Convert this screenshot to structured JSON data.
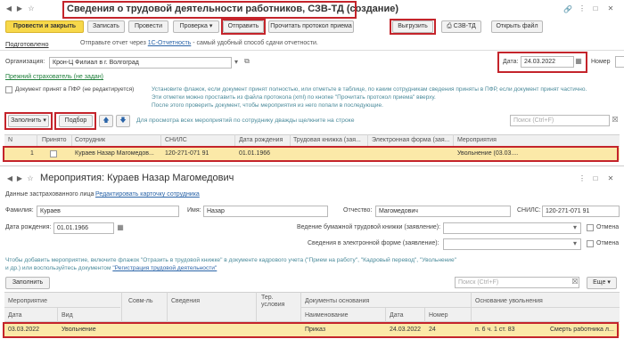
{
  "window": {
    "title": "Сведения о трудовой деятельности работников, СЗВ-ТД (создание)",
    "icons": [
      "link-icon",
      "more-icon",
      "maximize-icon",
      "close-icon",
      "back-icon",
      "forward-icon",
      "star-icon"
    ]
  },
  "tabs": {
    "active": "Подготовлено"
  },
  "toolbar": {
    "post_close": "Провести и закрыть",
    "save": "Записать",
    "post": "Провести",
    "check": "Проверка",
    "send": "Отправить",
    "read_protocol": "Прочитать протокол приема",
    "upload": "Выгрузить",
    "szv": "СЗВ-ТД",
    "open_file": "Открыть файл"
  },
  "notice": {
    "prefix": "Отправьте отчет через",
    "link": "1С-Отчетность",
    "suffix": "- самый удобный способ сдачи отчетности."
  },
  "org": {
    "label": "Организация:",
    "value": "Крон-Ц  Филиал в г. Волгоград",
    "date_label": "Дата:",
    "date_value": "24.03.2022",
    "number_label": "Номер"
  },
  "prev_insurer": "Прежний страхователь (не задан)",
  "accepted": {
    "label": "Документ принят в ПФР (не редактируется)",
    "hint1": "Установите флажок, если документ принят полностью, или отметьте в таблице, по каким сотрудникам сведения приняты в ПФР, если документ принят частично.",
    "hint2": "Эти отметки можно проставить из файла протокола (xml) по кнопке \"Прочитать протокол приема\" вверху.",
    "hint3": "После этого проверить документ, чтобы мероприятия из него попали в последующие."
  },
  "list_toolbar": {
    "fill": "Заполнить",
    "select": "Подбор",
    "hint": "Для просмотра всех мероприятий по сотруднику дважды щелкните на строке",
    "search": "Поиск (Ctrl+F)"
  },
  "table1": {
    "headers": [
      "N",
      "Принято",
      "Сотрудник",
      "СНИЛС",
      "Дата рождения",
      "Трудовая книжка (зая...",
      "Электронная форма (зая...",
      "Мероприятия"
    ],
    "rows": [
      {
        "n": "1",
        "accepted": "",
        "employee": "Кураев Назар Магомедов...",
        "snils": "120-271-071 91",
        "birth": "01.01.1966",
        "book": "",
        "eform": "",
        "events": "Увольнение (03.03...."
      }
    ]
  },
  "sub": {
    "title": "Мероприятия: Кураев Назар Магомедович",
    "insured_label": "Данные застрахованного лица",
    "edit_card": "Редактировать карточку сотрудника",
    "lastname_label": "Фамилия:",
    "lastname": "Кураев",
    "firstname_label": "Имя:",
    "firstname": "Назар",
    "middlename_label": "Отчество:",
    "middlename": "Магомедович",
    "snils_label": "СНИЛС:",
    "snils": "120-271-071 91",
    "birth_label": "Дата рождения:",
    "birth": "01.01.1966",
    "paper_label": "Ведение бумажной трудовой книжки (заявление):",
    "eform_label": "Сведения в электронной форме (заявление):",
    "cancel1": "Отмена",
    "cancel2": "Отмена",
    "hint1": "Чтобы добавить мероприятие, включите флажок \"Отразить в трудовой книжке\" в документе кадрового учета (\"Прием на работу\", \"Кадровый перевод\", \"Увольнение\"",
    "hint2_prefix": "и др.) или воспользуйтесь документом",
    "hint2_link": "\"Регистрация трудовой деятельности\"",
    "fill": "Заполнить",
    "search": "Поиск (Ctrl+F)",
    "more": "Еще"
  },
  "table2": {
    "headers_top": [
      "Мероприятие",
      "Совм-ль",
      "Сведения",
      "Тер. условия",
      "Документы основания",
      "Основание увольнения"
    ],
    "headers_bottom": [
      "Дата",
      "Вид",
      "Наименование",
      "Дата",
      "Номер"
    ],
    "rows": [
      {
        "date": "03.03.2022",
        "type": "Увольнение",
        "comb": "",
        "info": "",
        "terr": "",
        "doc_name": "Приказ",
        "doc_date": "24.03.2022",
        "doc_num": "24",
        "basis": "п. 6 ч. 1 ст. 83",
        "basis_text": "Смерть работника л..."
      }
    ]
  }
}
